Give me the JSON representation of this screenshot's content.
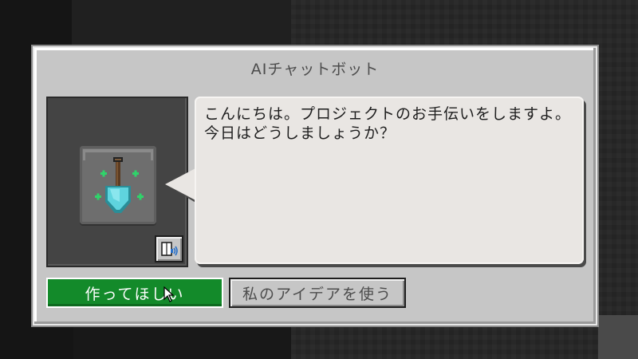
{
  "dialog": {
    "title": "AIチャットボット",
    "message": "こんにちは。プロジェクトのお手伝いをしますよ。今日はどうしましょうか？",
    "avatar_icon": "shovel-icon",
    "tts_icon": "book-speaker-icon",
    "buttons": {
      "primary_label": "作ってほしい",
      "secondary_label": "私のアイデアを使う"
    }
  },
  "colors": {
    "dialog_bg": "#c6c6c6",
    "primary_button": "#138a2a",
    "bubble_bg": "#e9e6e3",
    "avatar_bg": "#444444",
    "sparkle": "#2fd46a",
    "shovel_blade": "#4fc6d0"
  }
}
